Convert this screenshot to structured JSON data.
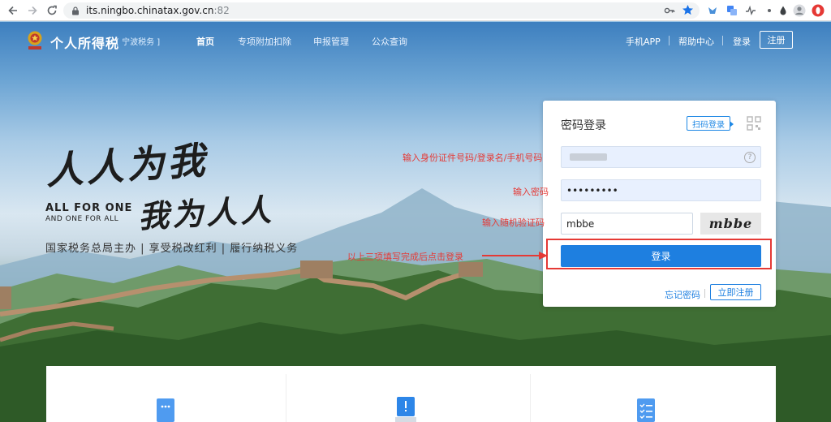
{
  "browser": {
    "url_host": "its.ningbo.chinatax.gov.cn",
    "url_port": ":82",
    "icons": [
      "back-icon",
      "forward-icon",
      "reload-icon",
      "lock-icon",
      "key-icon",
      "star-icon",
      "extension-icons",
      "profile-icon",
      "menu-icon"
    ]
  },
  "header": {
    "title": "个人所得税",
    "subtitle": "[ 宁波税务 ]",
    "nav": [
      "首页",
      "专项附加扣除",
      "申报管理",
      "公众查询"
    ],
    "mobile_app": "手机APP",
    "help_center": "帮助中心",
    "login": "登录",
    "register": "注册"
  },
  "hero": {
    "calligraphy_1": "人人为我",
    "calligraphy_2": "我为人人",
    "english_1": "ALL  FOR  ONE",
    "english_2": "AND ONE FOR ALL",
    "motto": "国家税务总局主办 | 享受税改红利 | 履行纳税义务"
  },
  "login_panel": {
    "title": "密码登录",
    "qr_tip": "扫码登录",
    "password_value": "•••••••••",
    "captcha_value": "mbbe",
    "captcha_image_text": "mbbe",
    "login_button": "登录",
    "forgot": "忘记密码",
    "register_now": "立即注册"
  },
  "annotations": {
    "id_hint": "输入身份证件号码/登录名/手机号码",
    "password_hint": "输入密码",
    "captcha_hint": "输入随机验证码",
    "login_hint": "以上三项填写完成后点击登录"
  },
  "colors": {
    "primary": "#1e7fe0",
    "annotation": "#e53935"
  }
}
